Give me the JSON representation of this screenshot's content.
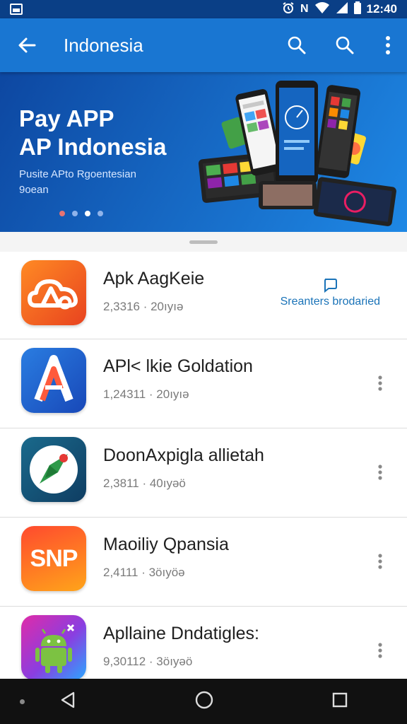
{
  "status_bar": {
    "icons": [
      "notification-icon",
      "alarm-icon",
      "nfc-icon",
      "wifi-icon",
      "signal-icon",
      "battery-icon"
    ],
    "nfc_glyph": "N",
    "time": "12:40"
  },
  "app_bar": {
    "title": "Indonesia",
    "icons": [
      "back-arrow-icon",
      "search-icon",
      "search-icon",
      "more-vert-icon"
    ]
  },
  "banner": {
    "title_line1": "Pay APP",
    "title_line2": "AP Indonesia",
    "subtitle": "Pusite APto Rgoentesian 9oean",
    "carousel_dots": 4,
    "active_dot": 3
  },
  "apps": [
    {
      "name": "Apk AagKeie",
      "meta": "2,3316 · 20ıyıə",
      "action_label": "Sreanters brodaried",
      "icon_colors": [
        "#ff7a1a",
        "#e8431f"
      ]
    },
    {
      "name": "APl< lkie Goldation",
      "meta": "1,24311 · 20ıyıə",
      "icon_colors": [
        "#2a7de1",
        "#1848b8"
      ]
    },
    {
      "name": "DoonAxpigla allietah",
      "meta": "2,3811 · 40ıyəö",
      "icon_colors": [
        "#1a6a8c",
        "#0f3d62"
      ]
    },
    {
      "name": "Maoiliy Qpansia",
      "meta": "2,4111 · 3öıyöə",
      "icon_text": "SNP",
      "icon_colors": [
        "#ff5a2e",
        "#ff9a1a"
      ]
    },
    {
      "name": "Apllaine Dndatigles:",
      "meta": "9,30112 · 3öıyəö",
      "icon_colors": [
        "#e02ba8",
        "#8a3ee0",
        "#2aa7ff"
      ]
    }
  ],
  "nav_bar": {
    "icons": [
      "back-triangle-icon",
      "home-circle-icon",
      "recents-square-icon"
    ]
  },
  "colors": {
    "status_bar": "#0a3f86",
    "app_bar": "#1976d2",
    "accent_link": "#1a73b8"
  }
}
